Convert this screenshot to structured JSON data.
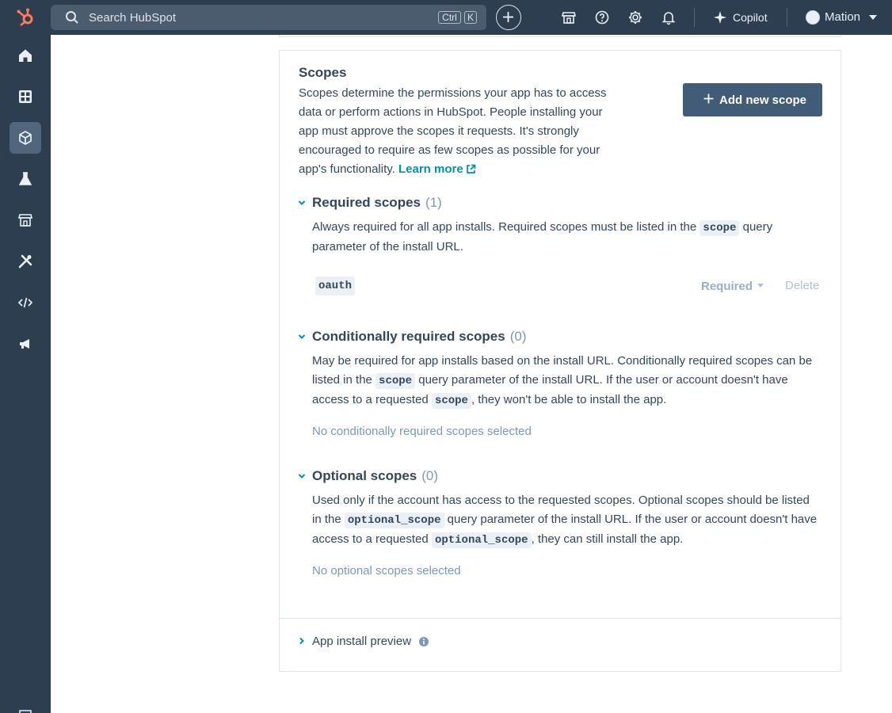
{
  "topbar": {
    "search_placeholder": "Search HubSpot",
    "shortcut_ctrl": "Ctrl",
    "shortcut_key": "K",
    "copilot_label": "Copilot",
    "account_name": "Mation"
  },
  "colors": {
    "nav_bg": "#2d3e50",
    "brand_orange": "#ff7a59",
    "primary_button": "#425b76",
    "link": "#0091ae",
    "text": "#33475b",
    "muted": "#7c98b6"
  },
  "sidebar": {
    "items": [
      {
        "icon": "home-icon"
      },
      {
        "icon": "dashboard-icon"
      },
      {
        "icon": "cube-icon",
        "active": true
      },
      {
        "icon": "flask-icon"
      },
      {
        "icon": "marketplace-icon"
      },
      {
        "icon": "tools-icon"
      },
      {
        "icon": "code-icon"
      },
      {
        "icon": "megaphone-icon"
      }
    ]
  },
  "scopes": {
    "title": "Scopes",
    "description": "Scopes determine the permissions your app has to access data or perform actions in HubSpot. People installing your app must approve the scopes it requests. It's strongly encouraged to require as few scopes as possible for your app's functionality.",
    "learn_more": "Learn more",
    "add_button": "Add new scope",
    "required": {
      "title": "Required scopes",
      "count": "(1)",
      "desc_1": "Always required for all app installs. Required scopes must be listed in the ",
      "code": "scope",
      "desc_2": " query parameter of the install URL.",
      "items": [
        {
          "name": "oauth",
          "type": "Required",
          "delete": "Delete"
        }
      ]
    },
    "conditional": {
      "title": "Conditionally required scopes",
      "count": "(0)",
      "desc_1": "May be required for app installs based on the install URL. Conditionally required scopes can be listed in the ",
      "code_1": "scope",
      "desc_2": " query parameter of the install URL. If the user or account doesn't have access to a requested ",
      "code_2": "scope",
      "desc_3": ", they won't be able to install the app.",
      "empty": "No conditionally required scopes selected"
    },
    "optional": {
      "title": "Optional scopes",
      "count": "(0)",
      "desc_1": "Used only if the account has access to the requested scopes. Optional scopes should be listed in the ",
      "code_1": "optional_scope",
      "desc_2": " query parameter of the install URL. If the user or account doesn't have access to a requested ",
      "code_2": "optional_scope",
      "desc_3": ", they can still install the app.",
      "empty": "No optional scopes selected"
    }
  },
  "app_install_preview": {
    "label": "App install preview"
  }
}
